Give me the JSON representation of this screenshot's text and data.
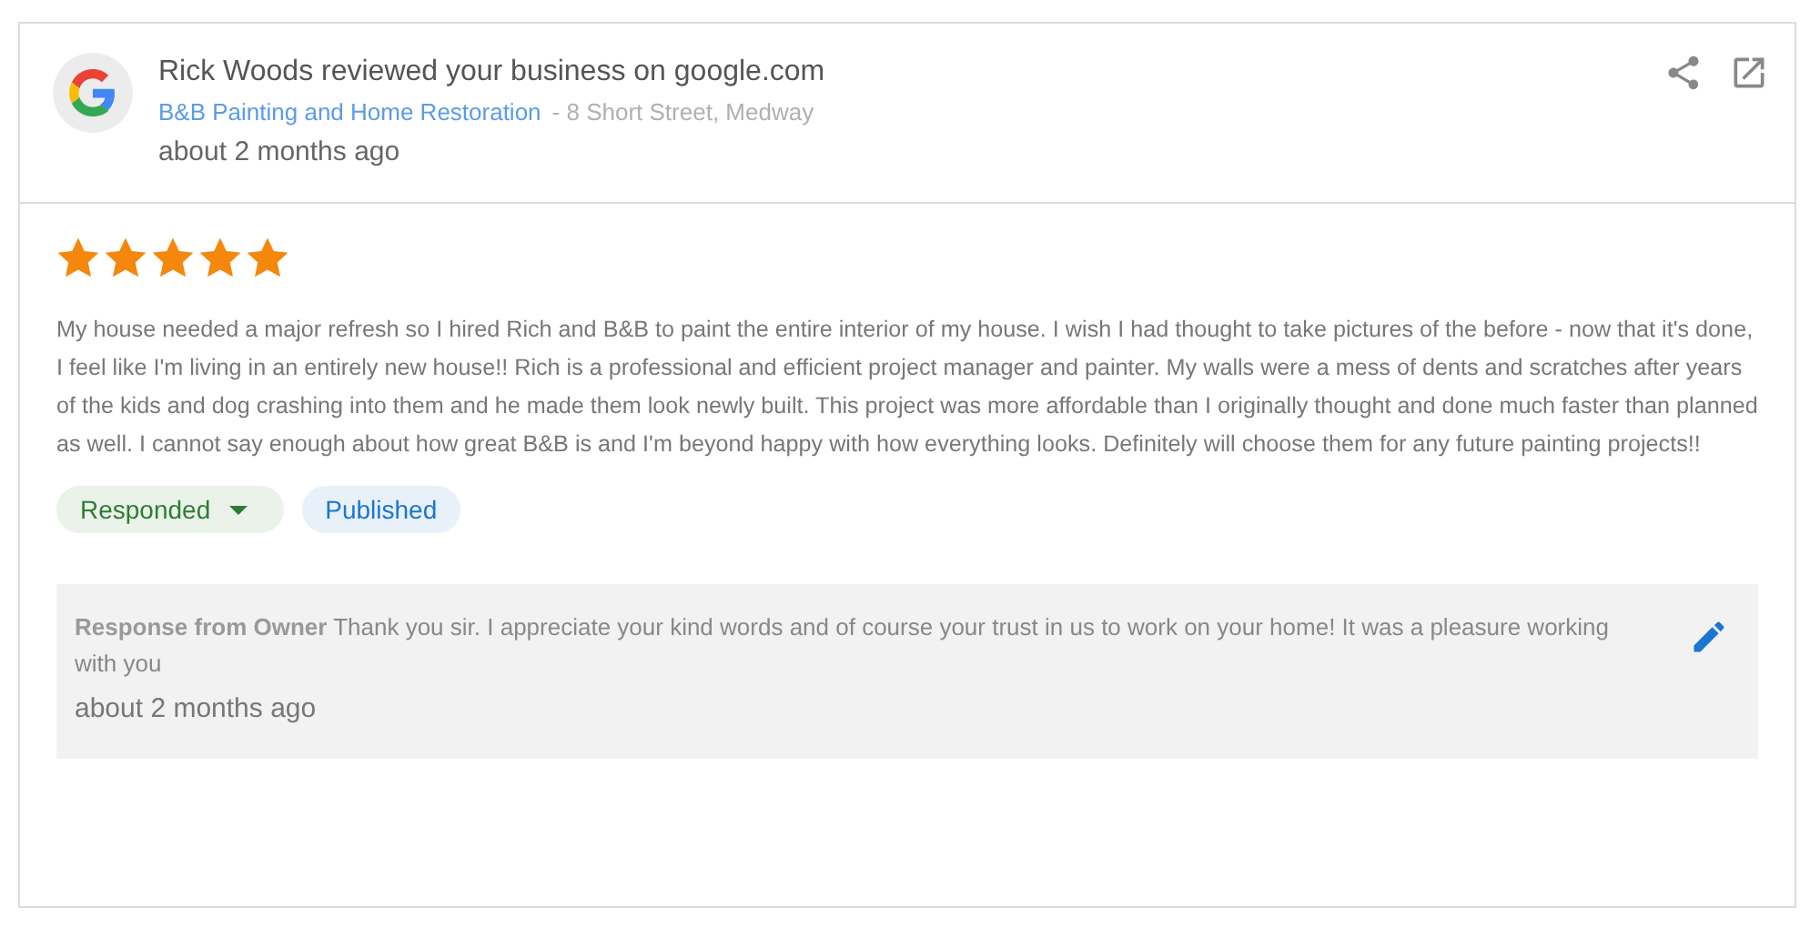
{
  "review": {
    "title": "Rick Woods reviewed your business on google.com",
    "business": "B&B Painting and Home Restoration",
    "address": "- 8 Short Street, Medway",
    "time": "about 2 months ago",
    "stars": 5,
    "text": "My house needed a major refresh so I hired Rich and B&B to paint the entire interior of my house. I wish I had thought to take pictures of the before - now that it's done, I feel like I'm living in an entirely new house!! Rich is a professional and efficient project manager and painter. My walls were a mess of dents and scratches after years of the kids and dog crashing into them and he made them look newly built. This project was more affordable than I originally thought and done much faster than planned as well. I cannot say enough about how great B&B is and I'm beyond happy with how everything looks. Definitely will choose them for any future painting projects!!",
    "chips": [
      {
        "label": "Responded",
        "kind": "dropdown",
        "color": "#2e7d32"
      },
      {
        "label": "Published",
        "kind": "plain",
        "color": "#1976d2"
      }
    ],
    "response": {
      "text": "**Response from Owner**   Thank you sir. I appreciate your kind words and of course your trust in us to work on your home! It was a pleasure working with you",
      "time": "about 2 months ago"
    }
  }
}
